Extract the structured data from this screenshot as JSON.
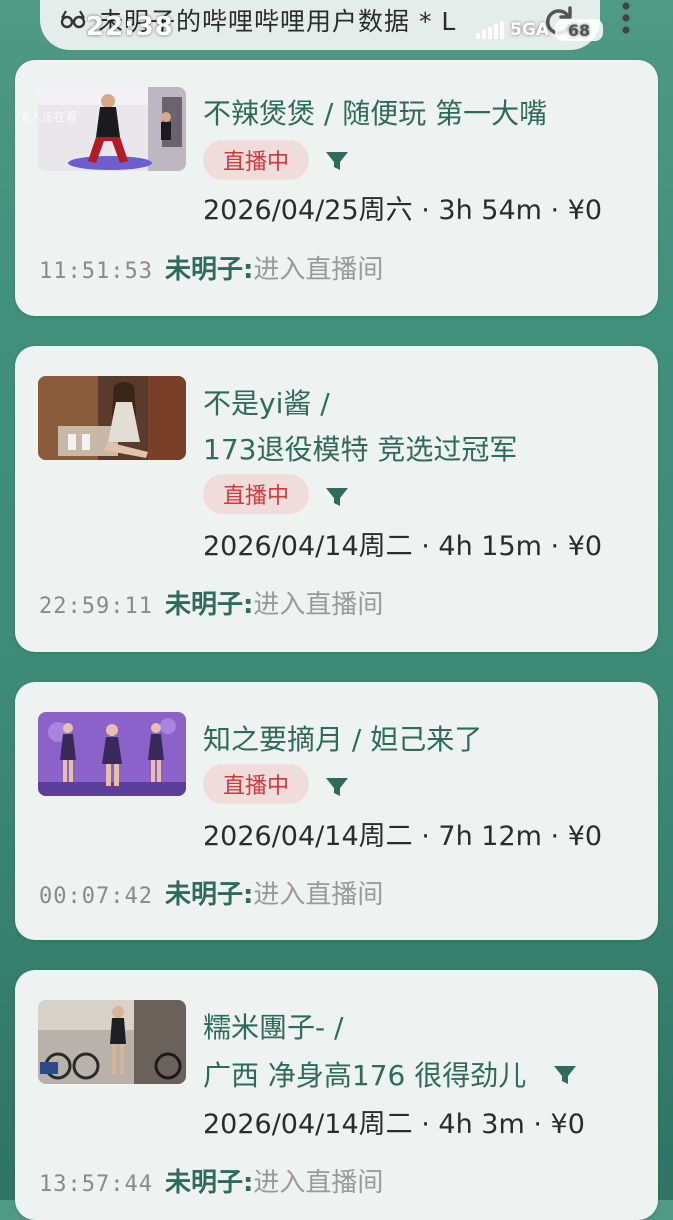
{
  "status_bar": {
    "time": "22:38",
    "network": "5GA",
    "battery": "68"
  },
  "header": {
    "title": "未明子的哔哩哔哩用户数据 * L"
  },
  "overlay": {
    "viewers": "6人正在看"
  },
  "colors": {
    "accent_green": "#2e6b58",
    "live_red": "#d0383a",
    "card_bg": "#eef2f0",
    "page_bg": "#3f8f7a"
  },
  "cards": [
    {
      "title_1": "不辣煲煲  /  随便玩 第一大嘴",
      "title_2": "",
      "badge": "直播中",
      "date": "2026/04/25周六",
      "duration": "3h 54m",
      "amount": "¥0",
      "time": "11:51:53",
      "user": "未明子:",
      "action": "进入直播间"
    },
    {
      "title_1": "不是yi酱  /",
      "title_2": "173退役模特 竞选过冠军",
      "badge": "直播中",
      "date": "2026/04/14周二",
      "duration": "4h 15m",
      "amount": "¥0",
      "time": "22:59:11",
      "user": "未明子:",
      "action": "进入直播间"
    },
    {
      "title_1": "知之要摘月  /  妲己来了",
      "title_2": "",
      "badge": "直播中",
      "date": "2026/04/14周二",
      "duration": "7h 12m",
      "amount": "¥0",
      "time": "00:07:42",
      "user": "未明子:",
      "action": "进入直播间"
    },
    {
      "title_1": "糯米團子-  /",
      "title_2": "广西 净身高176 很得劲儿",
      "badge": "",
      "date": "2026/04/14周二",
      "duration": "4h 3m",
      "amount": "¥0",
      "time": "13:57:44",
      "user": "未明子:",
      "action": "进入直播间"
    }
  ]
}
